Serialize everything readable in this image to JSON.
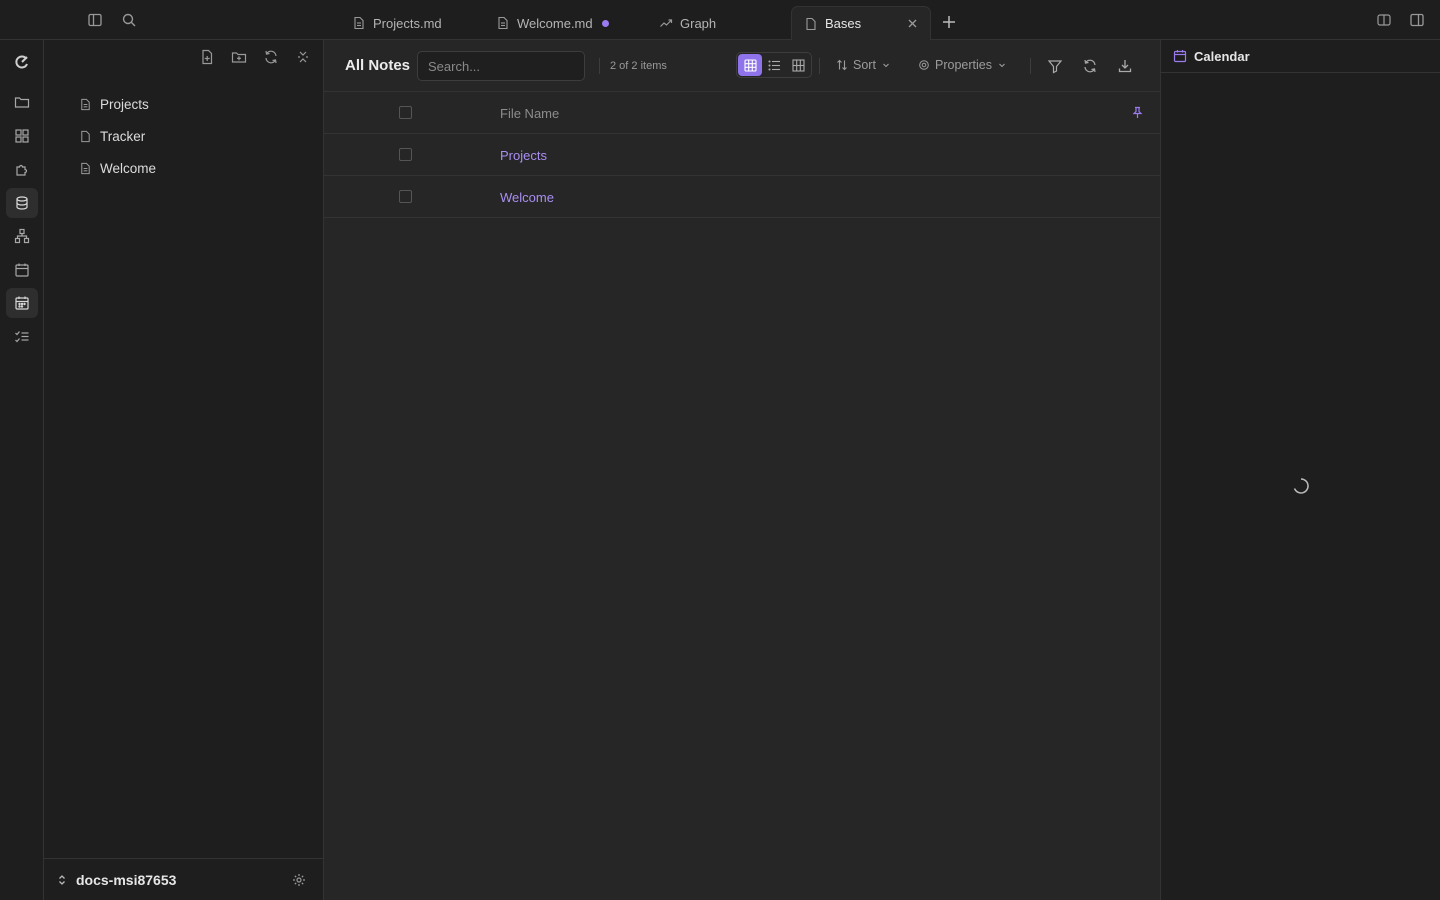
{
  "titlebar": {
    "tabs": [
      {
        "label": "Projects.md",
        "icon": "file-icon"
      },
      {
        "label": "Welcome.md",
        "icon": "file-icon",
        "unsaved": true
      },
      {
        "label": "Graph",
        "icon": "trend-icon"
      },
      {
        "label": "Bases",
        "icon": "file-icon",
        "active": true
      }
    ]
  },
  "ribbon": {
    "items": [
      "logo-icon",
      "folder-icon",
      "grid-icon",
      "puzzle-icon",
      "database-icon",
      "graph-icon",
      "calendar-icon",
      "calendar-days-icon",
      "checklist-icon"
    ],
    "selected": [
      "database-icon",
      "calendar-days-icon"
    ]
  },
  "explorer": {
    "files": [
      {
        "label": "Projects"
      },
      {
        "label": "Tracker"
      },
      {
        "label": "Welcome"
      }
    ],
    "vault_name": "docs-msi87653"
  },
  "bases": {
    "view_title": "All Notes",
    "search_placeholder": "Search...",
    "item_count": "2 of 2 items",
    "sort_label": "Sort",
    "properties_label": "Properties",
    "column_header": "File Name",
    "rows": [
      {
        "name": "Projects"
      },
      {
        "name": "Welcome"
      }
    ]
  },
  "right_panel": {
    "title": "Calendar",
    "loading": true
  },
  "colors": {
    "accent": "#8f73ea",
    "link": "#a98ef2",
    "background": "#1e1e1e",
    "editor_background": "#262626"
  }
}
